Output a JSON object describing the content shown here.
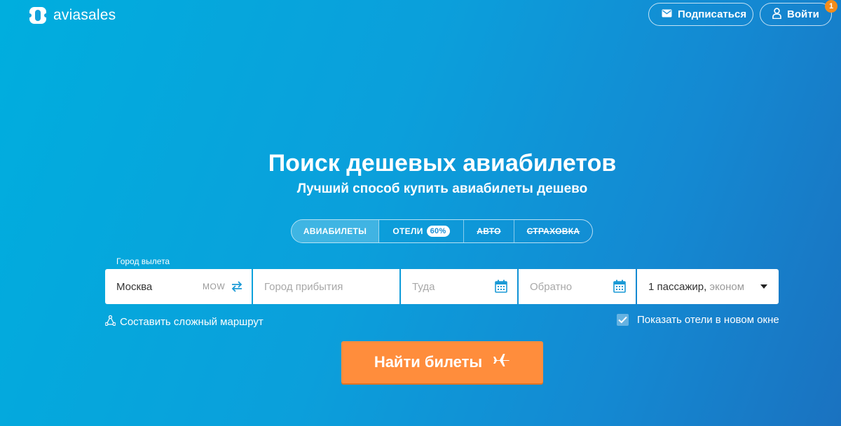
{
  "header": {
    "logo_text": "aviasales",
    "subscribe_label": "Подписаться",
    "login_label": "Войти",
    "notification_count": "1"
  },
  "hero": {
    "title": "Поиск дешевых авиабилетов",
    "subtitle": "Лучший способ купить авиабилеты дешево"
  },
  "tabs": [
    {
      "label": "АВИАБИЛЕТЫ",
      "active": true
    },
    {
      "label": "ОТЕЛИ",
      "badge": "60%"
    },
    {
      "label": "АВТО",
      "strikethrough": true
    },
    {
      "label": "СТРАХОВКА",
      "strikethrough": true
    }
  ],
  "search": {
    "origin_label": "Город вылета",
    "origin_value": "Москва",
    "origin_code": "MOW",
    "destination_placeholder": "Город прибытия",
    "depart_placeholder": "Туда",
    "return_placeholder": "Обратно",
    "passengers_value": "1 пассажир,",
    "cabin_class": "эконом"
  },
  "options": {
    "complex_route_label": "Составить сложный маршрут",
    "show_hotels_label": "Показать отели в новом окне",
    "show_hotels_checked": true
  },
  "action": {
    "search_label": "Найти билеты"
  },
  "colors": {
    "accent_orange": "#ff8d3c",
    "icon_blue": "#1b9ad6",
    "badge_orange": "#f48c1a"
  }
}
